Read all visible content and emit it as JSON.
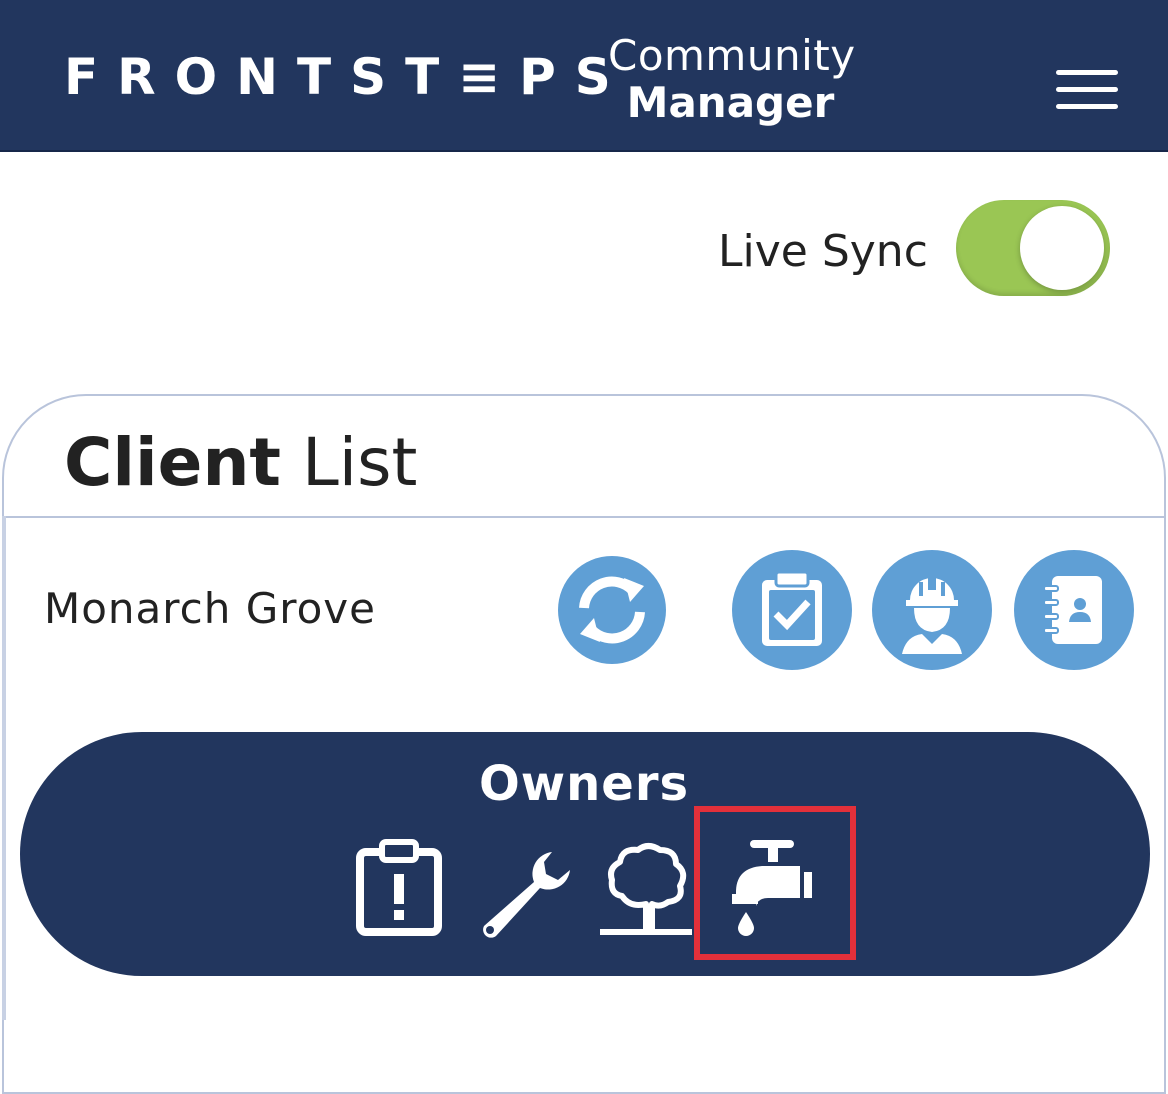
{
  "header": {
    "brand": "FRONTST≡PS",
    "product_line1": "Community",
    "product_line2": "Manager",
    "menu_icon": "hamburger-icon"
  },
  "live_sync": {
    "label": "Live Sync",
    "enabled": true,
    "track_color": "#9ac654"
  },
  "card": {
    "title_bold": "Client",
    "title_rest": "List"
  },
  "client": {
    "name": "Monarch Grove",
    "actions": [
      "sync-icon",
      "clipboard-check-icon",
      "worker-icon",
      "contacts-book-icon"
    ]
  },
  "owners": {
    "title": "Owners",
    "icons": [
      "clipboard-alert-icon",
      "wrench-icon",
      "tree-icon",
      "faucet-icon"
    ],
    "highlighted": "faucet-icon"
  },
  "colors": {
    "navy": "#22365e",
    "accent_blue": "#5f9fd5",
    "highlight_red": "#e3303a"
  }
}
